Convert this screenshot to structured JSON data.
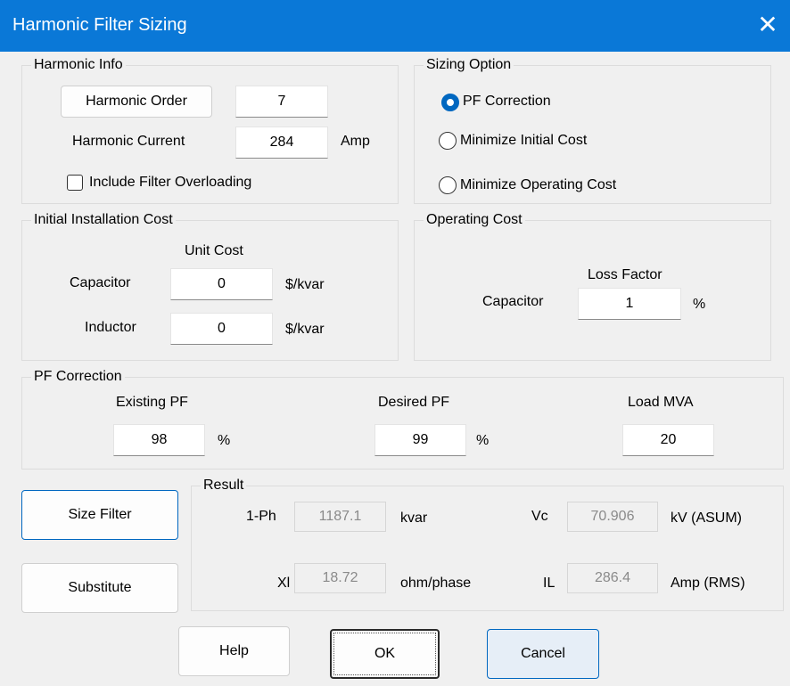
{
  "window": {
    "title": "Harmonic Filter Sizing",
    "close_glyph": "✕"
  },
  "harmonic_info": {
    "legend": "Harmonic Info",
    "order_button": "Harmonic Order",
    "order_value": "7",
    "current_label": "Harmonic Current",
    "current_value": "284",
    "current_unit": "Amp",
    "overload_label": "Include Filter Overloading"
  },
  "sizing_option": {
    "legend": "Sizing Option",
    "options": [
      "PF Correction",
      "Minimize Initial Cost",
      "Minimize Operating Cost"
    ],
    "selected": "PF Correction"
  },
  "initial_cost": {
    "legend": "Initial Installation Cost",
    "unit_cost_header": "Unit Cost",
    "capacitor_label": "Capacitor",
    "capacitor_value": "0",
    "inductor_label": "Inductor",
    "inductor_value": "0",
    "unit": "$/kvar"
  },
  "operating_cost": {
    "legend": "Operating Cost",
    "loss_factor_header": "Loss Factor",
    "capacitor_label": "Capacitor",
    "capacitor_value": "1",
    "unit": "%"
  },
  "pf_correction": {
    "legend": "PF Correction",
    "existing_label": "Existing PF",
    "existing_value": "98",
    "desired_label": "Desired PF",
    "desired_value": "99",
    "load_label": "Load MVA",
    "load_value": "20",
    "percent": "%"
  },
  "actions": {
    "size_filter": "Size Filter",
    "substitute": "Substitute"
  },
  "result": {
    "legend": "Result",
    "ph_label": "1-Ph",
    "ph_value": "1187.1",
    "ph_unit": "kvar",
    "vc_label": "Vc",
    "vc_value": "70.906",
    "vc_unit": "kV (ASUM)",
    "xl_label": "Xl",
    "xl_value": "18.72",
    "xl_unit": "ohm/phase",
    "il_label": "IL",
    "il_value": "286.4",
    "il_unit": "Amp (RMS)"
  },
  "footer": {
    "help": "Help",
    "ok": "OK",
    "cancel": "Cancel"
  },
  "colors": {
    "titlebar": "#0a78d7",
    "accent": "#0067c0",
    "background": "#f0f0f0"
  }
}
